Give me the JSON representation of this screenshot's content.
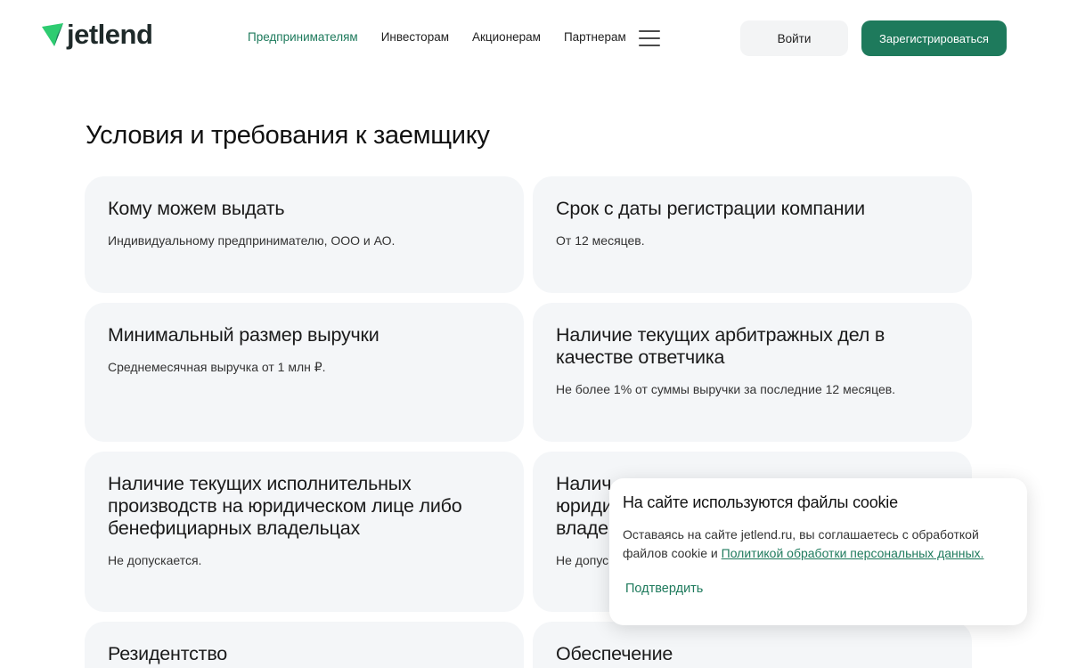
{
  "header": {
    "logo_text": "jetlend",
    "nav": [
      {
        "label": "Предпринимателям",
        "active": true
      },
      {
        "label": "Инвесторам",
        "active": false
      },
      {
        "label": "Акционерам",
        "active": false
      },
      {
        "label": "Партнерам",
        "active": false
      }
    ],
    "menu_icon": "hamburger-menu-icon",
    "login_label": "Войти",
    "register_label": "Зарегистрироваться"
  },
  "section": {
    "title": "Условия и требования к заемщику",
    "cards": [
      {
        "title": "Кому можем выдать",
        "text": "Индивидуальному предпринимателю, ООО и АО."
      },
      {
        "title": "Срок с даты регистрации  компании",
        "text": "От 12 месяцев."
      },
      {
        "title": "Минимальный размер выручки",
        "text": "Среднемесячная выручка от 1 млн ₽."
      },
      {
        "title": "Наличие текущих арбитражных дел в качестве ответчика",
        "text": "Не более 1% от суммы выручки  за последние 12 месяцев."
      },
      {
        "title": "Наличие текущих исполнительных производств на юридическом лице либо бенефициарных владельцах",
        "text": "Не допускается."
      },
      {
        "title": "Налич юриди владе",
        "text": "Не допус"
      },
      {
        "title": "Резидентство",
        "text": ""
      },
      {
        "title": "Обеспечение",
        "text": ""
      }
    ]
  },
  "cookie": {
    "title": "На сайте используются файлы cookie",
    "text": "Оставаясь на сайте jetlend.ru, вы соглашаетесь с обработкой файлов cookie и ",
    "link": "Политикой обработки персональных данных.",
    "confirm_label": "Подтвердить"
  },
  "colors": {
    "accent": "#1e7a5c",
    "logo_green": "#2ecc71",
    "card_bg": "#f4f6f8"
  }
}
